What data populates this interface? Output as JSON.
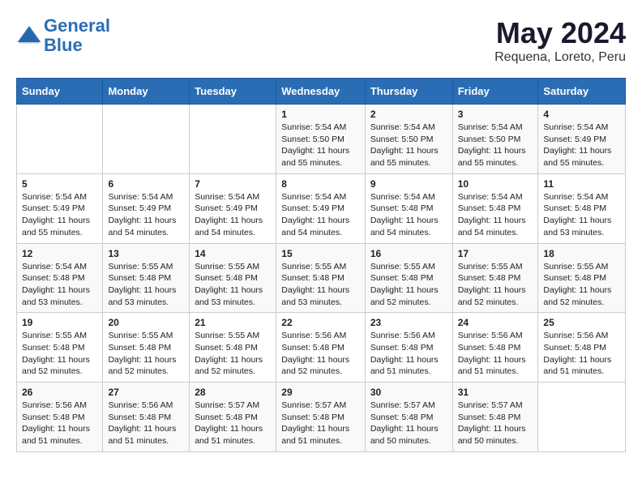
{
  "header": {
    "logo_line1": "General",
    "logo_line2": "Blue",
    "title": "May 2024",
    "location": "Requena, Loreto, Peru"
  },
  "days_of_week": [
    "Sunday",
    "Monday",
    "Tuesday",
    "Wednesday",
    "Thursday",
    "Friday",
    "Saturday"
  ],
  "weeks": [
    [
      {
        "day": "",
        "info": ""
      },
      {
        "day": "",
        "info": ""
      },
      {
        "day": "",
        "info": ""
      },
      {
        "day": "1",
        "info": "Sunrise: 5:54 AM\nSunset: 5:50 PM\nDaylight: 11 hours and 55 minutes."
      },
      {
        "day": "2",
        "info": "Sunrise: 5:54 AM\nSunset: 5:50 PM\nDaylight: 11 hours and 55 minutes."
      },
      {
        "day": "3",
        "info": "Sunrise: 5:54 AM\nSunset: 5:50 PM\nDaylight: 11 hours and 55 minutes."
      },
      {
        "day": "4",
        "info": "Sunrise: 5:54 AM\nSunset: 5:49 PM\nDaylight: 11 hours and 55 minutes."
      }
    ],
    [
      {
        "day": "5",
        "info": "Sunrise: 5:54 AM\nSunset: 5:49 PM\nDaylight: 11 hours and 55 minutes."
      },
      {
        "day": "6",
        "info": "Sunrise: 5:54 AM\nSunset: 5:49 PM\nDaylight: 11 hours and 54 minutes."
      },
      {
        "day": "7",
        "info": "Sunrise: 5:54 AM\nSunset: 5:49 PM\nDaylight: 11 hours and 54 minutes."
      },
      {
        "day": "8",
        "info": "Sunrise: 5:54 AM\nSunset: 5:49 PM\nDaylight: 11 hours and 54 minutes."
      },
      {
        "day": "9",
        "info": "Sunrise: 5:54 AM\nSunset: 5:48 PM\nDaylight: 11 hours and 54 minutes."
      },
      {
        "day": "10",
        "info": "Sunrise: 5:54 AM\nSunset: 5:48 PM\nDaylight: 11 hours and 54 minutes."
      },
      {
        "day": "11",
        "info": "Sunrise: 5:54 AM\nSunset: 5:48 PM\nDaylight: 11 hours and 53 minutes."
      }
    ],
    [
      {
        "day": "12",
        "info": "Sunrise: 5:54 AM\nSunset: 5:48 PM\nDaylight: 11 hours and 53 minutes."
      },
      {
        "day": "13",
        "info": "Sunrise: 5:55 AM\nSunset: 5:48 PM\nDaylight: 11 hours and 53 minutes."
      },
      {
        "day": "14",
        "info": "Sunrise: 5:55 AM\nSunset: 5:48 PM\nDaylight: 11 hours and 53 minutes."
      },
      {
        "day": "15",
        "info": "Sunrise: 5:55 AM\nSunset: 5:48 PM\nDaylight: 11 hours and 53 minutes."
      },
      {
        "day": "16",
        "info": "Sunrise: 5:55 AM\nSunset: 5:48 PM\nDaylight: 11 hours and 52 minutes."
      },
      {
        "day": "17",
        "info": "Sunrise: 5:55 AM\nSunset: 5:48 PM\nDaylight: 11 hours and 52 minutes."
      },
      {
        "day": "18",
        "info": "Sunrise: 5:55 AM\nSunset: 5:48 PM\nDaylight: 11 hours and 52 minutes."
      }
    ],
    [
      {
        "day": "19",
        "info": "Sunrise: 5:55 AM\nSunset: 5:48 PM\nDaylight: 11 hours and 52 minutes."
      },
      {
        "day": "20",
        "info": "Sunrise: 5:55 AM\nSunset: 5:48 PM\nDaylight: 11 hours and 52 minutes."
      },
      {
        "day": "21",
        "info": "Sunrise: 5:55 AM\nSunset: 5:48 PM\nDaylight: 11 hours and 52 minutes."
      },
      {
        "day": "22",
        "info": "Sunrise: 5:56 AM\nSunset: 5:48 PM\nDaylight: 11 hours and 52 minutes."
      },
      {
        "day": "23",
        "info": "Sunrise: 5:56 AM\nSunset: 5:48 PM\nDaylight: 11 hours and 51 minutes."
      },
      {
        "day": "24",
        "info": "Sunrise: 5:56 AM\nSunset: 5:48 PM\nDaylight: 11 hours and 51 minutes."
      },
      {
        "day": "25",
        "info": "Sunrise: 5:56 AM\nSunset: 5:48 PM\nDaylight: 11 hours and 51 minutes."
      }
    ],
    [
      {
        "day": "26",
        "info": "Sunrise: 5:56 AM\nSunset: 5:48 PM\nDaylight: 11 hours and 51 minutes."
      },
      {
        "day": "27",
        "info": "Sunrise: 5:56 AM\nSunset: 5:48 PM\nDaylight: 11 hours and 51 minutes."
      },
      {
        "day": "28",
        "info": "Sunrise: 5:57 AM\nSunset: 5:48 PM\nDaylight: 11 hours and 51 minutes."
      },
      {
        "day": "29",
        "info": "Sunrise: 5:57 AM\nSunset: 5:48 PM\nDaylight: 11 hours and 51 minutes."
      },
      {
        "day": "30",
        "info": "Sunrise: 5:57 AM\nSunset: 5:48 PM\nDaylight: 11 hours and 50 minutes."
      },
      {
        "day": "31",
        "info": "Sunrise: 5:57 AM\nSunset: 5:48 PM\nDaylight: 11 hours and 50 minutes."
      },
      {
        "day": "",
        "info": ""
      }
    ]
  ]
}
